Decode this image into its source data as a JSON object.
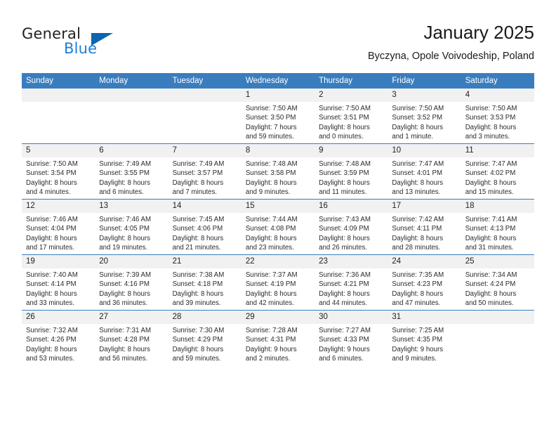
{
  "logo": {
    "word1": "General",
    "word2": "Blue",
    "triangle_color": "#0d64b0",
    "blue_color": "#1c7fd6"
  },
  "header": {
    "title": "January 2025",
    "subtitle": "Byczyna, Opole Voivodeship, Poland"
  },
  "theme": {
    "header_bg": "#3a7dbf",
    "daynum_bg": "#f1f1f1",
    "grid_line": "#3a7dbf",
    "text": "#2b2b2b"
  },
  "weekdays": [
    "Sunday",
    "Monday",
    "Tuesday",
    "Wednesday",
    "Thursday",
    "Friday",
    "Saturday"
  ],
  "weeks": [
    [
      {
        "day": "",
        "empty": true,
        "sunrise": "",
        "sunset": "",
        "daylight1": "",
        "daylight2": ""
      },
      {
        "day": "",
        "empty": true,
        "sunrise": "",
        "sunset": "",
        "daylight1": "",
        "daylight2": ""
      },
      {
        "day": "",
        "empty": true,
        "sunrise": "",
        "sunset": "",
        "daylight1": "",
        "daylight2": ""
      },
      {
        "day": "1",
        "empty": false,
        "sunrise": "Sunrise: 7:50 AM",
        "sunset": "Sunset: 3:50 PM",
        "daylight1": "Daylight: 7 hours",
        "daylight2": "and 59 minutes."
      },
      {
        "day": "2",
        "empty": false,
        "sunrise": "Sunrise: 7:50 AM",
        "sunset": "Sunset: 3:51 PM",
        "daylight1": "Daylight: 8 hours",
        "daylight2": "and 0 minutes."
      },
      {
        "day": "3",
        "empty": false,
        "sunrise": "Sunrise: 7:50 AM",
        "sunset": "Sunset: 3:52 PM",
        "daylight1": "Daylight: 8 hours",
        "daylight2": "and 1 minute."
      },
      {
        "day": "4",
        "empty": false,
        "sunrise": "Sunrise: 7:50 AM",
        "sunset": "Sunset: 3:53 PM",
        "daylight1": "Daylight: 8 hours",
        "daylight2": "and 3 minutes."
      }
    ],
    [
      {
        "day": "5",
        "empty": false,
        "sunrise": "Sunrise: 7:50 AM",
        "sunset": "Sunset: 3:54 PM",
        "daylight1": "Daylight: 8 hours",
        "daylight2": "and 4 minutes."
      },
      {
        "day": "6",
        "empty": false,
        "sunrise": "Sunrise: 7:49 AM",
        "sunset": "Sunset: 3:55 PM",
        "daylight1": "Daylight: 8 hours",
        "daylight2": "and 6 minutes."
      },
      {
        "day": "7",
        "empty": false,
        "sunrise": "Sunrise: 7:49 AM",
        "sunset": "Sunset: 3:57 PM",
        "daylight1": "Daylight: 8 hours",
        "daylight2": "and 7 minutes."
      },
      {
        "day": "8",
        "empty": false,
        "sunrise": "Sunrise: 7:48 AM",
        "sunset": "Sunset: 3:58 PM",
        "daylight1": "Daylight: 8 hours",
        "daylight2": "and 9 minutes."
      },
      {
        "day": "9",
        "empty": false,
        "sunrise": "Sunrise: 7:48 AM",
        "sunset": "Sunset: 3:59 PM",
        "daylight1": "Daylight: 8 hours",
        "daylight2": "and 11 minutes."
      },
      {
        "day": "10",
        "empty": false,
        "sunrise": "Sunrise: 7:47 AM",
        "sunset": "Sunset: 4:01 PM",
        "daylight1": "Daylight: 8 hours",
        "daylight2": "and 13 minutes."
      },
      {
        "day": "11",
        "empty": false,
        "sunrise": "Sunrise: 7:47 AM",
        "sunset": "Sunset: 4:02 PM",
        "daylight1": "Daylight: 8 hours",
        "daylight2": "and 15 minutes."
      }
    ],
    [
      {
        "day": "12",
        "empty": false,
        "sunrise": "Sunrise: 7:46 AM",
        "sunset": "Sunset: 4:04 PM",
        "daylight1": "Daylight: 8 hours",
        "daylight2": "and 17 minutes."
      },
      {
        "day": "13",
        "empty": false,
        "sunrise": "Sunrise: 7:46 AM",
        "sunset": "Sunset: 4:05 PM",
        "daylight1": "Daylight: 8 hours",
        "daylight2": "and 19 minutes."
      },
      {
        "day": "14",
        "empty": false,
        "sunrise": "Sunrise: 7:45 AM",
        "sunset": "Sunset: 4:06 PM",
        "daylight1": "Daylight: 8 hours",
        "daylight2": "and 21 minutes."
      },
      {
        "day": "15",
        "empty": false,
        "sunrise": "Sunrise: 7:44 AM",
        "sunset": "Sunset: 4:08 PM",
        "daylight1": "Daylight: 8 hours",
        "daylight2": "and 23 minutes."
      },
      {
        "day": "16",
        "empty": false,
        "sunrise": "Sunrise: 7:43 AM",
        "sunset": "Sunset: 4:09 PM",
        "daylight1": "Daylight: 8 hours",
        "daylight2": "and 26 minutes."
      },
      {
        "day": "17",
        "empty": false,
        "sunrise": "Sunrise: 7:42 AM",
        "sunset": "Sunset: 4:11 PM",
        "daylight1": "Daylight: 8 hours",
        "daylight2": "and 28 minutes."
      },
      {
        "day": "18",
        "empty": false,
        "sunrise": "Sunrise: 7:41 AM",
        "sunset": "Sunset: 4:13 PM",
        "daylight1": "Daylight: 8 hours",
        "daylight2": "and 31 minutes."
      }
    ],
    [
      {
        "day": "19",
        "empty": false,
        "sunrise": "Sunrise: 7:40 AM",
        "sunset": "Sunset: 4:14 PM",
        "daylight1": "Daylight: 8 hours",
        "daylight2": "and 33 minutes."
      },
      {
        "day": "20",
        "empty": false,
        "sunrise": "Sunrise: 7:39 AM",
        "sunset": "Sunset: 4:16 PM",
        "daylight1": "Daylight: 8 hours",
        "daylight2": "and 36 minutes."
      },
      {
        "day": "21",
        "empty": false,
        "sunrise": "Sunrise: 7:38 AM",
        "sunset": "Sunset: 4:18 PM",
        "daylight1": "Daylight: 8 hours",
        "daylight2": "and 39 minutes."
      },
      {
        "day": "22",
        "empty": false,
        "sunrise": "Sunrise: 7:37 AM",
        "sunset": "Sunset: 4:19 PM",
        "daylight1": "Daylight: 8 hours",
        "daylight2": "and 42 minutes."
      },
      {
        "day": "23",
        "empty": false,
        "sunrise": "Sunrise: 7:36 AM",
        "sunset": "Sunset: 4:21 PM",
        "daylight1": "Daylight: 8 hours",
        "daylight2": "and 44 minutes."
      },
      {
        "day": "24",
        "empty": false,
        "sunrise": "Sunrise: 7:35 AM",
        "sunset": "Sunset: 4:23 PM",
        "daylight1": "Daylight: 8 hours",
        "daylight2": "and 47 minutes."
      },
      {
        "day": "25",
        "empty": false,
        "sunrise": "Sunrise: 7:34 AM",
        "sunset": "Sunset: 4:24 PM",
        "daylight1": "Daylight: 8 hours",
        "daylight2": "and 50 minutes."
      }
    ],
    [
      {
        "day": "26",
        "empty": false,
        "sunrise": "Sunrise: 7:32 AM",
        "sunset": "Sunset: 4:26 PM",
        "daylight1": "Daylight: 8 hours",
        "daylight2": "and 53 minutes."
      },
      {
        "day": "27",
        "empty": false,
        "sunrise": "Sunrise: 7:31 AM",
        "sunset": "Sunset: 4:28 PM",
        "daylight1": "Daylight: 8 hours",
        "daylight2": "and 56 minutes."
      },
      {
        "day": "28",
        "empty": false,
        "sunrise": "Sunrise: 7:30 AM",
        "sunset": "Sunset: 4:29 PM",
        "daylight1": "Daylight: 8 hours",
        "daylight2": "and 59 minutes."
      },
      {
        "day": "29",
        "empty": false,
        "sunrise": "Sunrise: 7:28 AM",
        "sunset": "Sunset: 4:31 PM",
        "daylight1": "Daylight: 9 hours",
        "daylight2": "and 2 minutes."
      },
      {
        "day": "30",
        "empty": false,
        "sunrise": "Sunrise: 7:27 AM",
        "sunset": "Sunset: 4:33 PM",
        "daylight1": "Daylight: 9 hours",
        "daylight2": "and 6 minutes."
      },
      {
        "day": "31",
        "empty": false,
        "sunrise": "Sunrise: 7:25 AM",
        "sunset": "Sunset: 4:35 PM",
        "daylight1": "Daylight: 9 hours",
        "daylight2": "and 9 minutes."
      },
      {
        "day": "",
        "empty": true,
        "sunrise": "",
        "sunset": "",
        "daylight1": "",
        "daylight2": ""
      }
    ]
  ]
}
